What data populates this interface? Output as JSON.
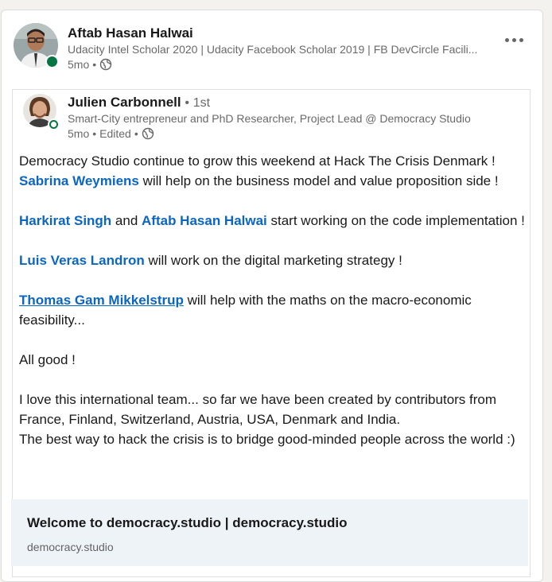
{
  "author": {
    "name": "Aftab Hasan Halwai",
    "headline": "Udacity Intel Scholar 2020 | Udacity Facebook Scholar 2019 | FB DevCircle Facili...",
    "time": "5mo",
    "separator": "•",
    "visibility_icon": "globe-icon",
    "online": true
  },
  "menu": {
    "icon": "more-icon"
  },
  "shared": {
    "name": "Julien Carbonnell",
    "degree_sep": "•",
    "degree": "1st",
    "headline": "Smart-City entrepreneur and PhD Researcher, Project Lead @ Democracy Studio",
    "time": "5mo",
    "separator": "•",
    "edited": "Edited",
    "separator2": "•",
    "visibility_icon": "globe-icon",
    "online": true
  },
  "post": {
    "line1": "Democracy Studio continue to grow this weekend at Hack The Crisis Denmark !",
    "mention1": "Sabrina Weymiens",
    "line2": " will help on the business model and value proposition side !",
    "mention2": "Harkirat Singh",
    "line3a": " and ",
    "mention3": "Aftab Hasan Halwai",
    "line3b": " start working on the code implementation !",
    "mention4": "Luis Veras Landron",
    "line4": " will work on the digital marketing strategy !",
    "mention5": "Thomas Gam Mikkelstrup",
    "line5": " will help with the maths on the macro-economic feasibility...",
    "line6": "All good !",
    "line7": "I love this international team... so far we have been created by contributors from France, Finland, Switzerland, Austria, USA, Denmark and India.",
    "line8": "The best way to hack the crisis is to bridge good-minded people across the world :)"
  },
  "link_preview": {
    "title": "Welcome to democracy.studio | democracy.studio",
    "domain": "democracy.studio"
  },
  "colors": {
    "link": "#0a66c2",
    "online": "#057642",
    "preview_bg": "#eef3f8"
  }
}
